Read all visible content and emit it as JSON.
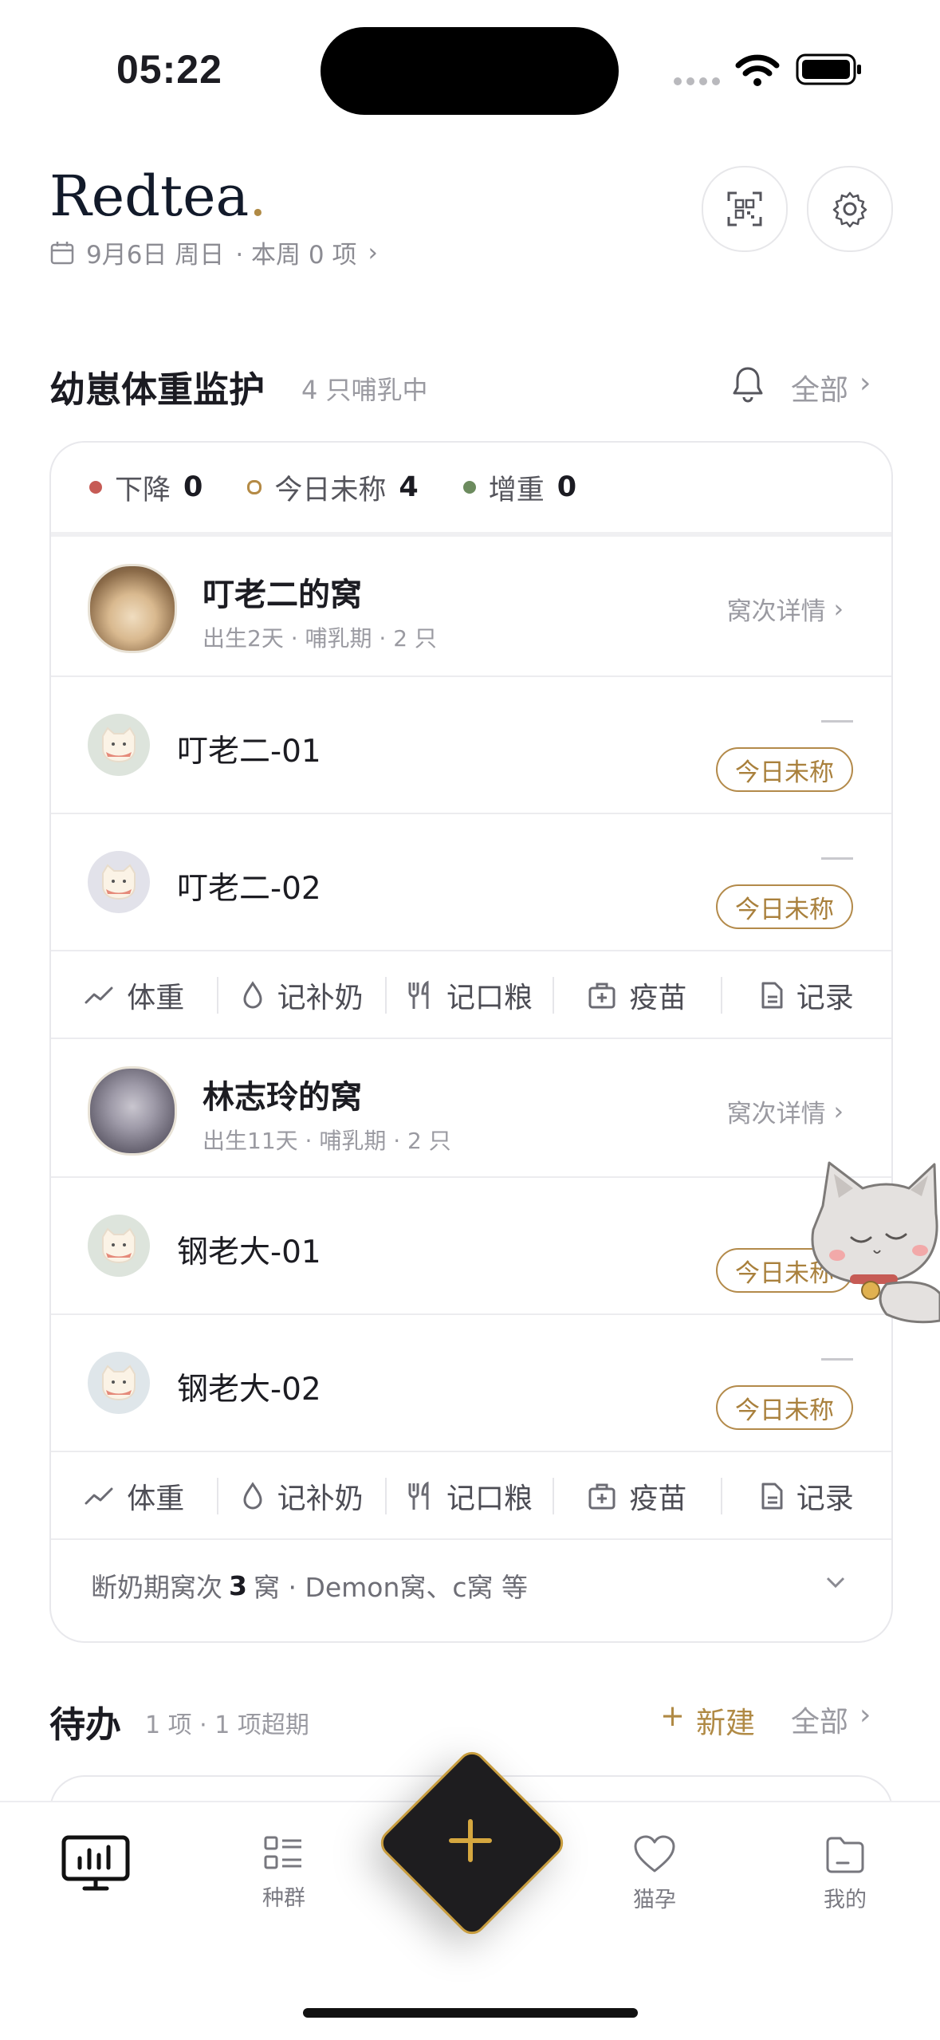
{
  "status_bar": {
    "time": "05:22"
  },
  "header": {
    "brand": "Redtea",
    "brand_dot": ".",
    "date_text": "9月6日 周日",
    "week_summary": "· 本周 0 项"
  },
  "kitten_section": {
    "title": "幼崽体重监护",
    "subtitle": "4 只哺乳中",
    "all_label": "全部",
    "legend": [
      {
        "label": "下降",
        "count": "0",
        "color": "#c65b55"
      },
      {
        "label": "今日未称",
        "count": "4",
        "color": "#b48a45"
      },
      {
        "label": "增重",
        "count": "0",
        "color": "#6c8b5e"
      }
    ],
    "litters": [
      {
        "name": "叮老二的窝",
        "meta": "出生2天 · 哺乳期 · 2 只",
        "detail_label": "窝次详情",
        "kittens": [
          {
            "name": "叮老二-01",
            "weight": "—",
            "badge": "今日未称"
          },
          {
            "name": "叮老二-02",
            "weight": "—",
            "badge": "今日未称"
          }
        ]
      },
      {
        "name": "林志玲的窝",
        "meta": "出生11天 · 哺乳期 · 2 只",
        "detail_label": "窝次详情",
        "kittens": [
          {
            "name": "钢老大-01",
            "weight": "",
            "badge": "今日未称"
          },
          {
            "name": "钢老大-02",
            "weight": "—",
            "badge": "今日未称"
          }
        ]
      }
    ],
    "actions": [
      {
        "label": "体重",
        "icon": "trend-icon"
      },
      {
        "label": "记补奶",
        "icon": "drop-icon"
      },
      {
        "label": "记口粮",
        "icon": "utensils-icon"
      },
      {
        "label": "疫苗",
        "icon": "medkit-icon"
      },
      {
        "label": "记录",
        "icon": "document-icon"
      }
    ],
    "weaning": {
      "prefix": "断奶期窝次",
      "count": "3",
      "suffix": "窝 · Demon窝、c窝 等"
    }
  },
  "todo_section": {
    "title": "待办",
    "subtitle": "1 项 · 1 项超期",
    "new_label": "新建",
    "all_label": "全部"
  },
  "tabbar": {
    "tabs": [
      {
        "label": "",
        "icon": "dashboard-icon"
      },
      {
        "label": "种群",
        "icon": "list-icon"
      },
      {
        "label": "猫孕",
        "icon": "heart-icon"
      },
      {
        "label": "我的",
        "icon": "folder-icon"
      }
    ]
  },
  "colors": {
    "accent": "#b08a45",
    "fab": "#1e1d1f"
  }
}
